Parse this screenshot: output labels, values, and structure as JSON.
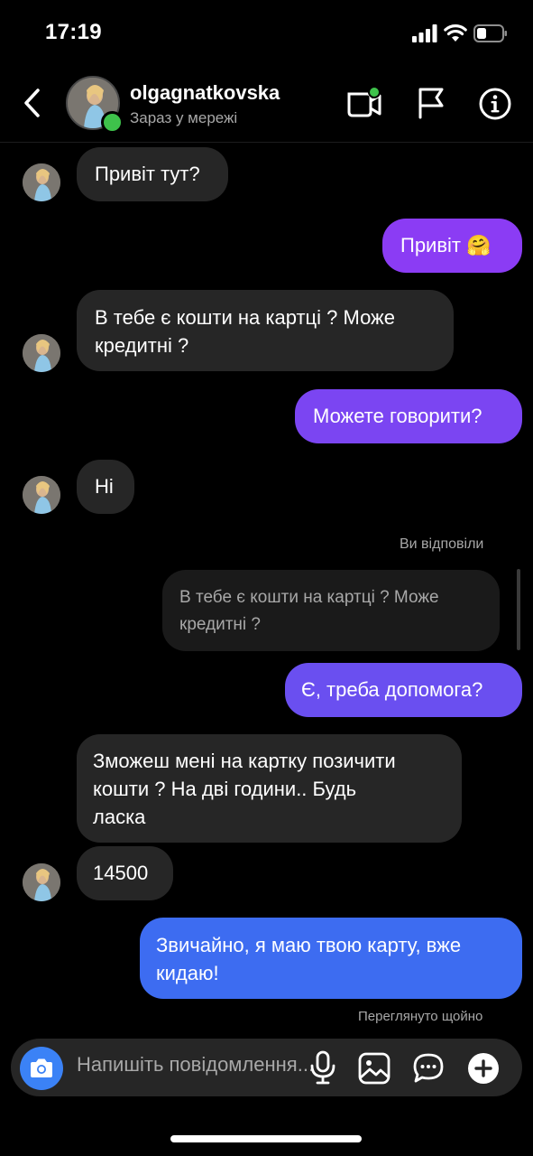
{
  "status_bar": {
    "time": "17:19"
  },
  "header": {
    "username": "olgagnatkovska",
    "status": "Зараз у мережі"
  },
  "messages": {
    "m1": "Привіт тут?",
    "m2": "Привіт 🤗",
    "m3_line1": "В тебе є кошти на картці ? Може",
    "m3_line2": "кредитні ?",
    "m4": "Можете говорити?",
    "m5": "Ні",
    "reply_label": "Ви відповіли",
    "quoted_line1": "В тебе є кошти на картці ? Може",
    "quoted_line2": "кредитні ?",
    "m6": "Є, треба допомога?",
    "m7_line1": "Зможеш мені на картку позичити",
    "m7_line2": "кошти ? На дві години.. Будь",
    "m7_line3": "ласка",
    "m8": "14500",
    "m9_line1": "Звичайно, я маю твою карту, вже",
    "m9_line2": "кидаю!",
    "seen": "Переглянуто щойно"
  },
  "composer": {
    "placeholder": "Напишіть повідомлення..."
  },
  "colors": {
    "outgoing_1": "#8b3cf4",
    "outgoing_2": "#7b45f2",
    "outgoing_3": "#6a4ff0",
    "outgoing_4": "#3d6cf1",
    "incoming": "#262626",
    "online": "#3ec24b"
  }
}
